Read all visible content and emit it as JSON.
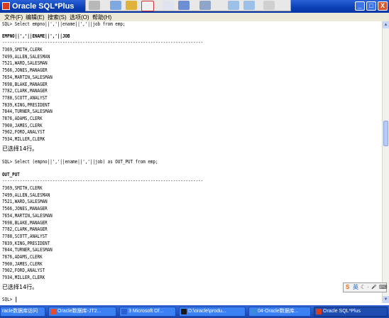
{
  "window": {
    "title": "Oracle SQL*Plus",
    "minimize": "_",
    "maximize": "□",
    "close": "X"
  },
  "menu": [
    "文件(F)",
    "编辑(E)",
    "搜索(S)",
    "选项(O)",
    "帮助(H)"
  ],
  "console": {
    "query1": "SQL> Select empno||','||ename||','||job from emp;",
    "header1": "EMPNO||','||ENAME||','||JOB",
    "divider": "--------------------------------------------------------------------------------",
    "rows": [
      "7369,SMITH,CLERK",
      "7499,ALLEN,SALESMAN",
      "7521,WARD,SALESMAN",
      "7566,JONES,MANAGER",
      "7654,MARTIN,SALESMAN",
      "7698,BLAKE,MANAGER",
      "7782,CLARK,MANAGER",
      "7788,SCOTT,ANALYST",
      "7839,KING,PRESIDENT",
      "7844,TURNER,SALESMAN",
      "7876,ADAMS,CLERK",
      "7900,JAMES,CLERK",
      "7902,FORD,ANALYST",
      "7934,MILLER,CLERK"
    ],
    "rows_selected": "已选择14行。",
    "query2": "SQL> Select (empno||','||ename||','||job) as OUT_PUT from emp;",
    "header2": "OUT_PUT",
    "prompt": "SQL> "
  },
  "ime": {
    "logo": "S",
    "lang": "英",
    "moon": "☾",
    "dot": "·",
    "mic": "🎤",
    "kbd": "⌨"
  },
  "taskbar": [
    {
      "label": "racle数据库访问",
      "color": "#e8a23c"
    },
    {
      "label": "Oracle数据库-JT2...",
      "color": "#e34d2f"
    },
    {
      "label": "3 Microsoft Of...",
      "color": "#2a5fcf"
    },
    {
      "label": "D:\\oracle\\produ...",
      "color": "#1a1a1a"
    },
    {
      "label": "04-Oracle数据库...",
      "color": "#3b8bd8"
    },
    {
      "label": "Oracle SQL*Plus",
      "color": "#d83c1f"
    }
  ]
}
